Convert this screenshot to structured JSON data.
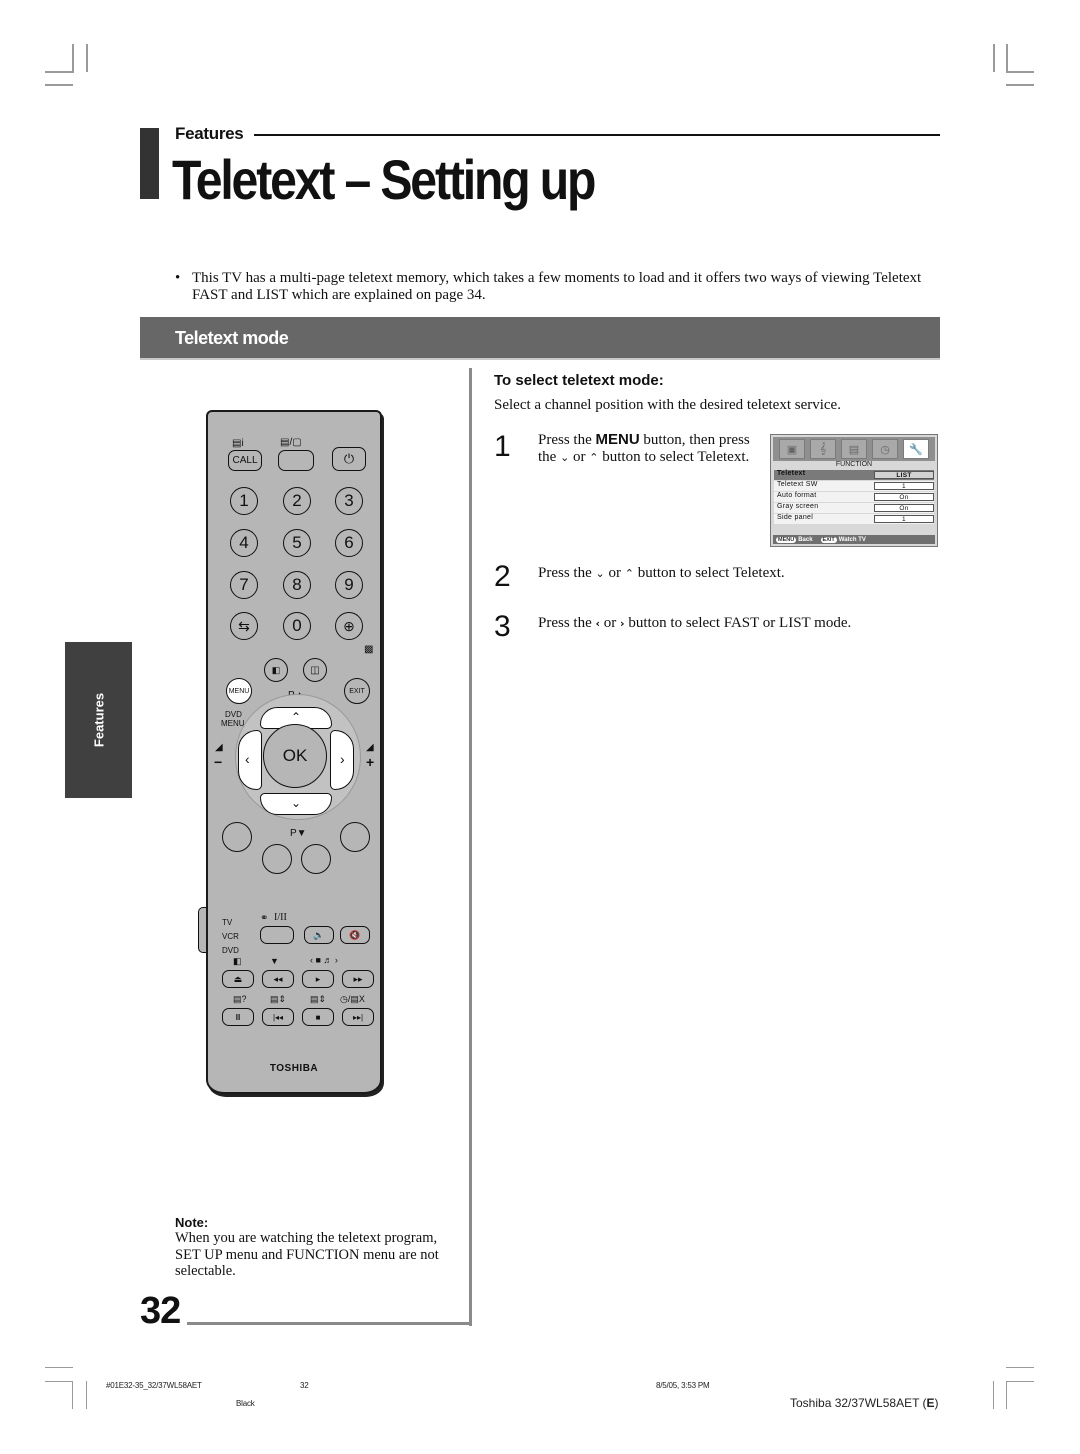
{
  "header": {
    "section_label": "Features",
    "title": "Teletext – Setting up"
  },
  "intro": {
    "bullet": "•",
    "text": "This TV has a multi-page teletext memory, which takes a few moments to load and it offers two ways of viewing Teletext FAST and LIST which are explained on page 34."
  },
  "section": {
    "title": "Teletext mode"
  },
  "side_tab": {
    "label": "Features"
  },
  "procedure": {
    "heading": "To select teletext mode:",
    "intro": "Select a channel position with the desired teletext service.",
    "steps": [
      {
        "number": "1",
        "pre": "Press the ",
        "bold": "MENU",
        "mid": " button, then press the ",
        "icon1": "⌄",
        "or": " or ",
        "icon2": "⌃",
        "post": " button to select Teletext."
      },
      {
        "number": "2",
        "pre": "Press the ",
        "icon1": "⌄",
        "or": " or ",
        "icon2": "⌃",
        "post": " button to select Teletext."
      },
      {
        "number": "3",
        "pre": "Press the ",
        "icon1": "‹",
        "or": " or ",
        "icon2": "›",
        "post": " button to select FAST or LIST mode."
      }
    ]
  },
  "osd_menu": {
    "tab_icons": [
      "picture-icon",
      "sound-icon",
      "feature-icon",
      "timer-icon",
      "setup-wrench-icon"
    ],
    "title": "FUNCTION",
    "rows": [
      {
        "label": "Teletext",
        "value": "LIST",
        "selected": true
      },
      {
        "label": "Teletext SW",
        "value": "1"
      },
      {
        "label": "Auto format",
        "value": "On"
      },
      {
        "label": "Gray screen",
        "value": "On"
      },
      {
        "label": "Side panel",
        "value": "1"
      }
    ],
    "footer": {
      "back_key": "MENU",
      "back_label": "Back",
      "exit_key": "EXIT",
      "exit_label": "Watch TV"
    }
  },
  "remote": {
    "call": "CALL",
    "numbers": [
      "1",
      "2",
      "3",
      "4",
      "5",
      "6",
      "7",
      "8",
      "9",
      "0"
    ],
    "menu": "MENU",
    "exit": "EXIT",
    "dvd_menu_1": "DVD",
    "dvd_menu_2": "MENU",
    "p_up": "P▲",
    "p_down": "P▼",
    "ok": "OK",
    "vol_minus": "−",
    "vol_plus": "+",
    "source_tv": "TV",
    "source_vcr": "VCR",
    "source_dvd": "DVD",
    "stereo": "I/II",
    "brand": "TOSHIBA",
    "transport_row1": [
      "⏏",
      "◂◂",
      "▸",
      "▸▸"
    ],
    "transport_row2": [
      "II",
      "|◂◂",
      "■",
      "▸▸|"
    ]
  },
  "note": {
    "title": "Note:",
    "text": "When you are watching the teletext program, SET UP menu and FUNCTION menu are not selectable."
  },
  "page_number": "32",
  "footer": {
    "file": "#01E32-35_32/37WL58AET",
    "page": "32",
    "color_plate": "Black",
    "date": "8/5/05, 3:53 PM",
    "model_pre": "Toshiba 32/37WL58AET (",
    "model_bold": "E",
    "model_post": ")"
  }
}
